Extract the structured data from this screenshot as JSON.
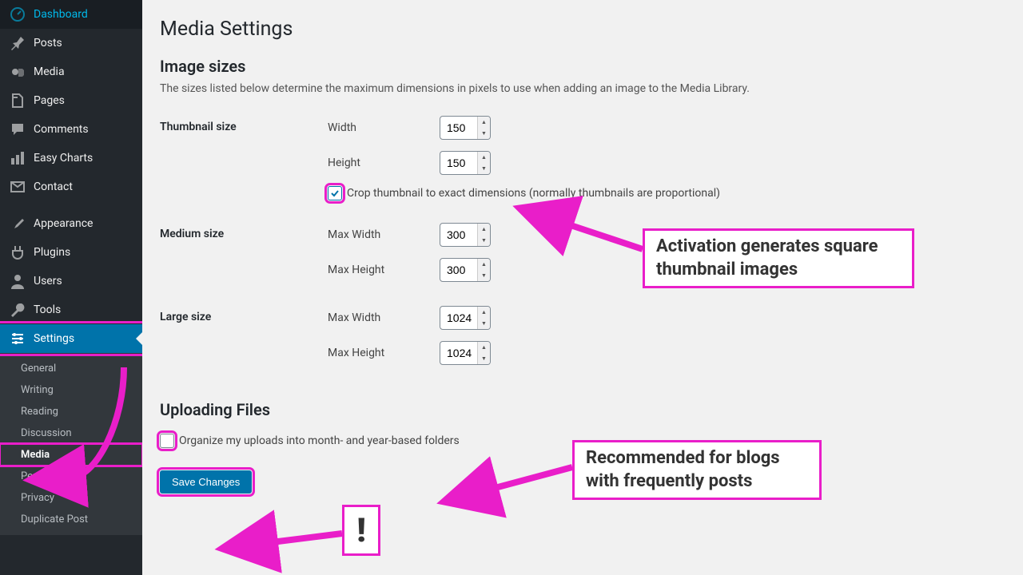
{
  "sidebar": {
    "items": [
      {
        "label": "Dashboard"
      },
      {
        "label": "Posts"
      },
      {
        "label": "Media"
      },
      {
        "label": "Pages"
      },
      {
        "label": "Comments"
      },
      {
        "label": "Easy Charts"
      },
      {
        "label": "Contact"
      },
      {
        "label": "Appearance"
      },
      {
        "label": "Plugins"
      },
      {
        "label": "Users"
      },
      {
        "label": "Tools"
      },
      {
        "label": "Settings"
      }
    ],
    "submenu": [
      {
        "label": "General"
      },
      {
        "label": "Writing"
      },
      {
        "label": "Reading"
      },
      {
        "label": "Discussion"
      },
      {
        "label": "Media"
      },
      {
        "label": "Permalinks"
      },
      {
        "label": "Privacy"
      },
      {
        "label": "Duplicate Post"
      }
    ]
  },
  "page": {
    "title": "Media Settings",
    "section_image_sizes": "Image sizes",
    "desc": "The sizes listed below determine the maximum dimensions in pixels to use when adding an image to the Media Library.",
    "thumb_label": "Thumbnail size",
    "width_label": "Width",
    "height_label": "Height",
    "thumb_w": "150",
    "thumb_h": "150",
    "crop_label": "Crop thumbnail to exact dimensions (normally thumbnails are proportional)",
    "medium_label": "Medium size",
    "maxw_label": "Max Width",
    "maxh_label": "Max Height",
    "medium_w": "300",
    "medium_h": "300",
    "large_label": "Large size",
    "large_w": "1024",
    "large_h": "1024",
    "section_uploading": "Uploading Files",
    "org_label": "Organize my uploads into month- and year-based folders",
    "save": "Save Changes"
  },
  "anno": {
    "a1": "Activation generates square thumbnail images",
    "a2": "Recommended for blogs with frequently posts",
    "bang": "!"
  }
}
